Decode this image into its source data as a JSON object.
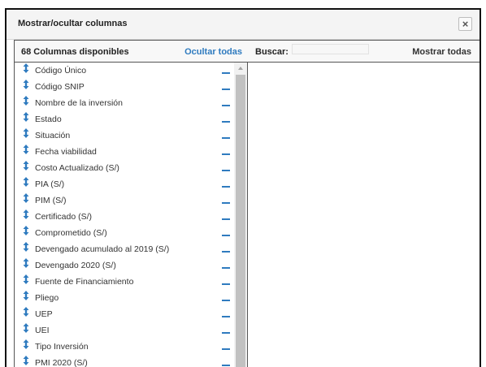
{
  "dialog": {
    "title": "Mostrar/ocultar columnas",
    "close_label": "×"
  },
  "available": {
    "count_label": "68 Columnas disponibles",
    "hide_all_label": "Ocultar todas",
    "drag_icon": "drag-updown-icon",
    "remove_icon": "minus-icon",
    "accent_color": "#2f7bbf",
    "items": [
      "Código Único",
      "Código SNIP",
      "Nombre de la inversión",
      "Estado",
      "Situación",
      "Fecha viabilidad",
      "Costo Actualizado (S/)",
      "PIA (S/)",
      "PIM (S/)",
      "Certificado (S/)",
      "Comprometido (S/)",
      "Devengado acumulado al 2019 (S/)",
      "Devengado 2020 (S/)",
      "Fuente de Financiamiento",
      "Pliego",
      "UEP",
      "UEI",
      "Tipo Inversión",
      "PMI 2020 (S/)"
    ]
  },
  "selected": {
    "search_label": "Buscar:",
    "search_value": "",
    "show_all_label": "Mostrar todas"
  }
}
